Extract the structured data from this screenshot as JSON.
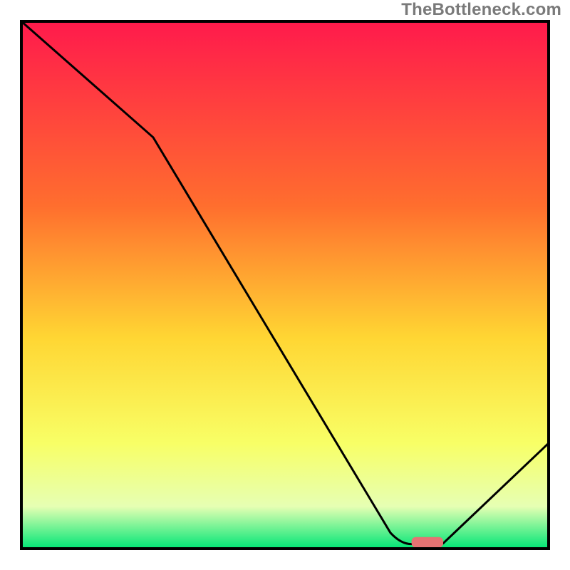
{
  "watermark": "TheBottleneck.com",
  "colors": {
    "gradient_top": "#ff1a4c",
    "gradient_mid1": "#ff6e2e",
    "gradient_mid2": "#ffd633",
    "gradient_mid3": "#f8ff66",
    "gradient_mid4": "#e6ffb3",
    "gradient_bottom": "#00e676",
    "curve": "#000000",
    "marker": "#e57373",
    "border": "#000000"
  },
  "chart_data": {
    "type": "line",
    "title": "",
    "xlabel": "",
    "ylabel": "",
    "xlim": [
      0,
      100
    ],
    "ylim": [
      0,
      100
    ],
    "x": [
      0,
      25,
      70,
      75,
      80,
      100
    ],
    "values": [
      100,
      78,
      3,
      1,
      1,
      20
    ],
    "marker": {
      "x": 77,
      "y": 1.2,
      "w": 6,
      "h": 2
    },
    "annotations": []
  }
}
